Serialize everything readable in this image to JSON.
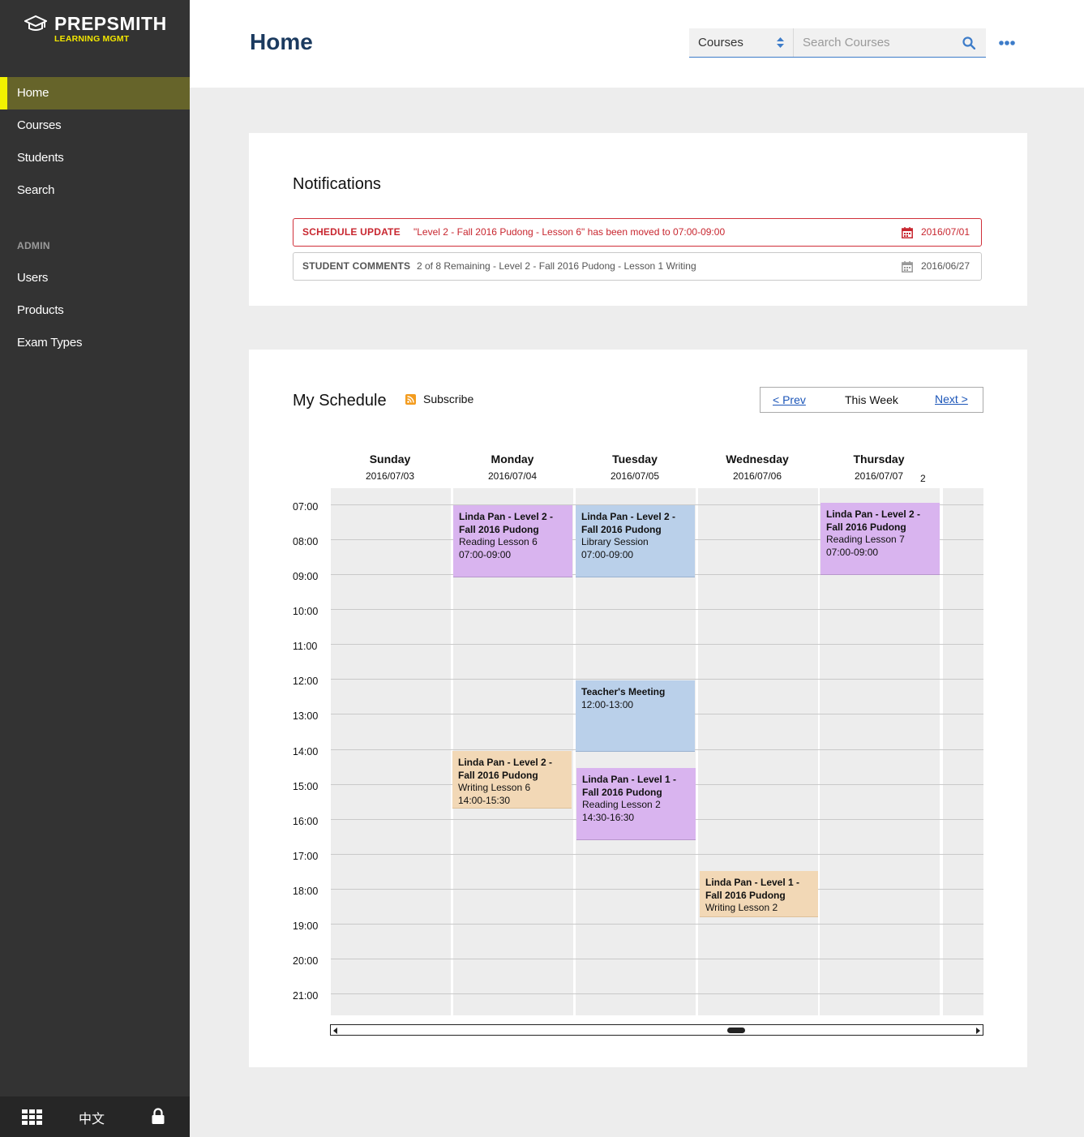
{
  "brand": {
    "name": "PREPSMITH",
    "tagline": "LEARNING MGMT"
  },
  "sidebar": {
    "items": [
      {
        "label": "Home",
        "active": true
      },
      {
        "label": "Courses"
      },
      {
        "label": "Students"
      },
      {
        "label": "Search"
      }
    ],
    "admin_title": "ADMIN",
    "admin_items": [
      {
        "label": "Users"
      },
      {
        "label": "Products"
      },
      {
        "label": "Exam Types"
      }
    ],
    "footer": {
      "apps_icon": "grid-icon",
      "language": "中文",
      "lock_icon": "lock-icon"
    }
  },
  "header": {
    "title": "Home",
    "select_value": "Courses",
    "search_placeholder": "Search Courses",
    "more_icon": "more-icon"
  },
  "notifications": {
    "title": "Notifications",
    "items": [
      {
        "type": "SCHEDULE UPDATE",
        "message": "\"Level 2 - Fall 2016 Pudong - Lesson 6\" has been moved to 07:00-09:00",
        "date": "2016/07/01",
        "status_color": "#c8262f"
      },
      {
        "type": "STUDENT COMMENTS",
        "message": "2 of 8 Remaining -  Level 2 - Fall 2016 Pudong - Lesson 1 Writing",
        "date": "2016/06/27"
      }
    ]
  },
  "schedule": {
    "title": "My Schedule",
    "subscribe_label": "Subscribe",
    "nav": {
      "prev": "< Prev",
      "current": "This Week",
      "next": "Next >"
    },
    "days": [
      {
        "name": "Sunday",
        "date": "2016/07/03"
      },
      {
        "name": "Monday",
        "date": "2016/07/04"
      },
      {
        "name": "Tuesday",
        "date": "2016/07/05"
      },
      {
        "name": "Wednesday",
        "date": "2016/07/06"
      },
      {
        "name": "Thursday",
        "date": "2016/07/07"
      },
      {
        "name": "",
        "date": "2"
      }
    ],
    "hours": [
      "07:00",
      "08:00",
      "09:00",
      "10:00",
      "11:00",
      "12:00",
      "13:00",
      "14:00",
      "15:00",
      "16:00",
      "17:00",
      "18:00",
      "19:00",
      "20:00",
      "21:00"
    ],
    "events": [
      {
        "title": "Linda Pan - Level 2 - Fall 2016 Pudong",
        "subtitle": "Reading Lesson 6",
        "time": "07:00-09:00",
        "color": "#d9b4ef"
      },
      {
        "title": "Linda Pan - Level 2 - Fall 2016 Pudong",
        "subtitle": "Library Session",
        "time": "07:00-09:00",
        "color": "#bad0ea"
      },
      {
        "title": "Linda Pan - Level 2 - Fall 2016 Pudong",
        "subtitle": "Reading Lesson 7",
        "time": "07:00-09:00",
        "color": "#d9b4ef"
      },
      {
        "title": "Teacher's Meeting",
        "subtitle": "",
        "time": "12:00-13:00",
        "color": "#bad0ea"
      },
      {
        "title": "Linda Pan - Level 2 - Fall 2016 Pudong",
        "subtitle": "Writing Lesson 6",
        "time": "14:00-15:30",
        "color": "#f2d8b6"
      },
      {
        "title": "Linda Pan - Level 1 - Fall 2016 Pudong",
        "subtitle": "Reading Lesson 2",
        "time": "14:30-16:30",
        "color": "#d9b4ef"
      },
      {
        "title": "Linda Pan - Level 1 - Fall 2016 Pudong",
        "subtitle": "Writing Lesson 2",
        "time": "",
        "color": "#f2d8b6"
      }
    ]
  }
}
